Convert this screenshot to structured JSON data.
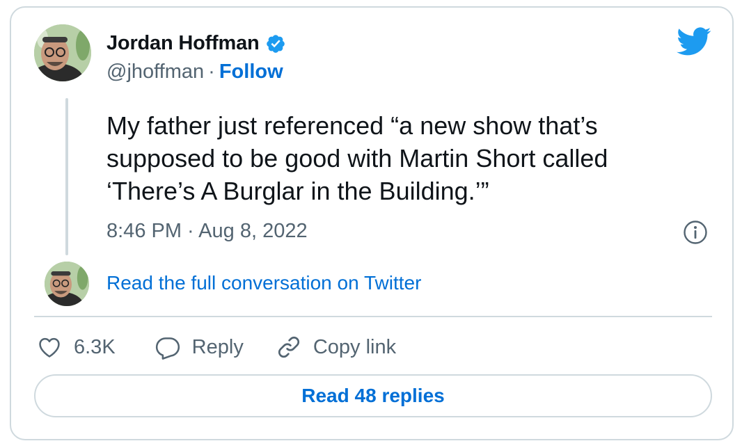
{
  "author": {
    "display_name": "Jordan Hoffman",
    "handle": "@jhoffman",
    "separator": "·",
    "follow_label": "Follow",
    "avatar_icon": "person-avatar",
    "verified_icon": "verified-badge-icon"
  },
  "tweet": {
    "text": "My father just referenced “a new show that’s supposed to be good with Martin Short called ‘There’s A Burglar in the Building.’”",
    "timestamp": "8:46 PM · Aug 8, 2022"
  },
  "conversation": {
    "link_label": "Read the full conversation on Twitter"
  },
  "actions": {
    "like_count": "6.3K",
    "reply_label": "Reply",
    "copy_link_label": "Copy link"
  },
  "replies_button": {
    "label": "Read 48 replies"
  },
  "colors": {
    "accent": "#1d9bf0",
    "link": "#006fd6",
    "text": "#0f1419",
    "secondary": "#536471",
    "border": "#cfd9de"
  }
}
